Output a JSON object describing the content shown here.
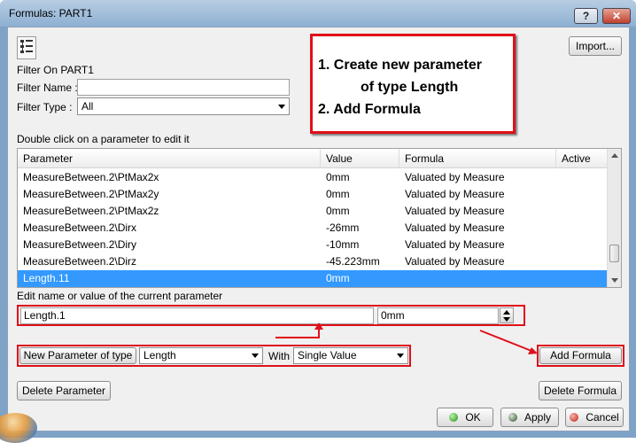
{
  "window": {
    "title": "Formulas: PART1",
    "help_label": "?",
    "close_label": "✕"
  },
  "toolbar": {
    "import_label": "Import..."
  },
  "filter": {
    "filter_on_label": "Filter On PART1",
    "name_label": "Filter Name :",
    "name_value": "",
    "type_label": "Filter Type :",
    "type_value": "All"
  },
  "annotation": {
    "line1": "1. Create new parameter",
    "line2": "of type Length",
    "line3": "2. Add Formula"
  },
  "table": {
    "caption": "Double click on a parameter to edit it",
    "headers": [
      "Parameter",
      "Value",
      "Formula",
      "Active"
    ],
    "rows": [
      {
        "parameter": "MeasureBetween.2\\PtMax2x",
        "value": "0mm",
        "formula": "Valuated by Measure",
        "active": ""
      },
      {
        "parameter": "MeasureBetween.2\\PtMax2y",
        "value": "0mm",
        "formula": "Valuated by Measure",
        "active": ""
      },
      {
        "parameter": "MeasureBetween.2\\PtMax2z",
        "value": "0mm",
        "formula": "Valuated by Measure",
        "active": ""
      },
      {
        "parameter": "MeasureBetween.2\\Dirx",
        "value": "-26mm",
        "formula": "Valuated by Measure",
        "active": ""
      },
      {
        "parameter": "MeasureBetween.2\\Diry",
        "value": "-10mm",
        "formula": "Valuated by Measure",
        "active": ""
      },
      {
        "parameter": "MeasureBetween.2\\Dirz",
        "value": "-45.223mm",
        "formula": "Valuated by Measure",
        "active": ""
      },
      {
        "parameter": "Length.11",
        "value": "0mm",
        "formula": "",
        "active": ""
      }
    ]
  },
  "edit": {
    "label": "Edit name or value of the current parameter",
    "name_value": "Length.1",
    "value_value": "0mm"
  },
  "new_param": {
    "button_label": "New Parameter of type",
    "type_value": "Length",
    "with_label": "With",
    "with_value": "Single Value"
  },
  "buttons": {
    "add_formula": "Add Formula",
    "delete_parameter": "Delete Parameter",
    "delete_formula": "Delete Formula",
    "ok": "OK",
    "apply": "Apply",
    "cancel": "Cancel"
  },
  "colors": {
    "annotation_red": "#e0101a",
    "selection_blue": "#3399ff",
    "title_bar": "#9ab8d8"
  }
}
